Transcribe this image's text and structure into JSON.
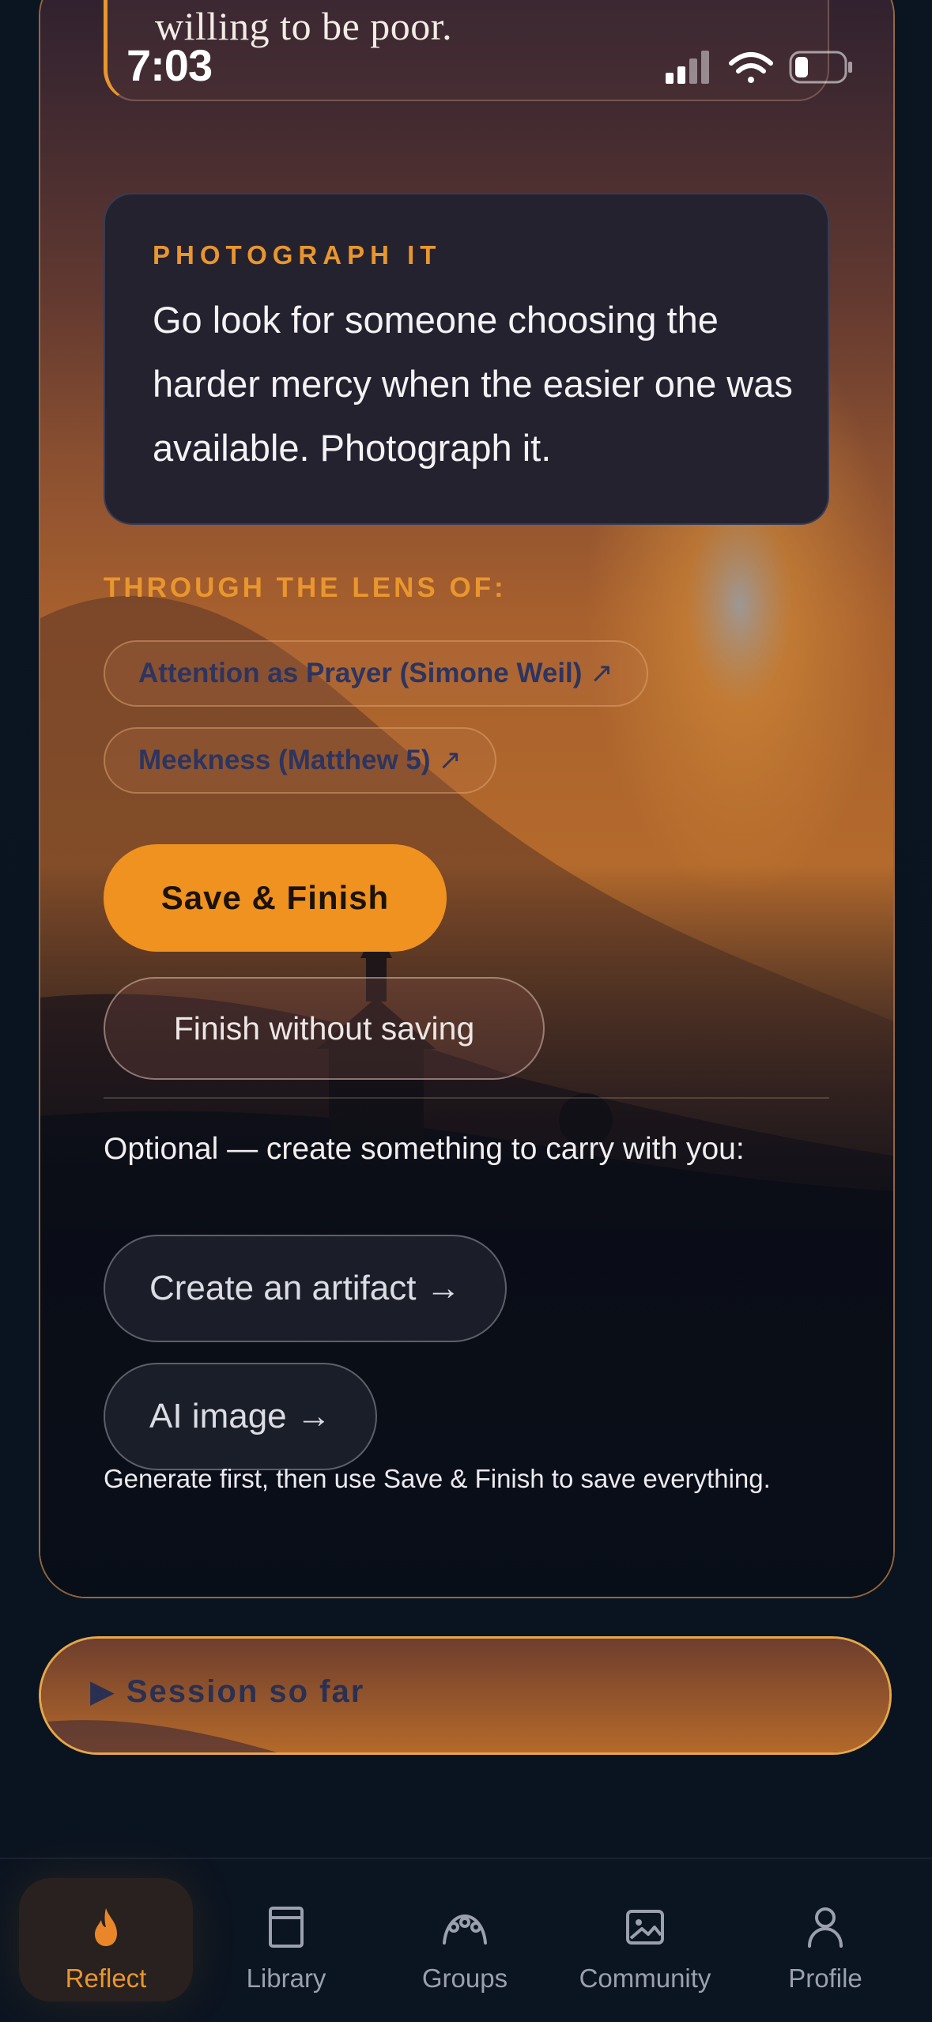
{
  "status_bar": {
    "time": "7:03"
  },
  "reflection": {
    "quote_tail": "willing to be poor.",
    "photograph": {
      "label": "PHOTOGRAPH IT",
      "prompt": "Go look for someone choosing the harder mercy when the easier one was available. Photograph it."
    },
    "lens": {
      "label": "THROUGH THE LENS OF:",
      "chips": [
        {
          "label": "Attention as Prayer (Simone Weil)",
          "arrow": "↗"
        },
        {
          "label": "Meekness (Matthew 5)",
          "arrow": "↗"
        }
      ]
    },
    "actions": {
      "save_label": "Save & Finish",
      "finish_label": "Finish without saving"
    },
    "optional": {
      "intro": "Optional — create something to carry with you:",
      "artifact_label": "Create an artifact →",
      "ai_image_label": "AI image →",
      "helper": "Generate first, then use Save & Finish to save everything."
    }
  },
  "session": {
    "label": "▶ Session so far"
  },
  "nav": {
    "items": [
      {
        "label": "Reflect",
        "icon": "flame-icon",
        "active": true
      },
      {
        "label": "Library",
        "icon": "book-icon"
      },
      {
        "label": "Groups",
        "icon": "groups-icon"
      },
      {
        "label": "Community",
        "icon": "image-icon"
      },
      {
        "label": "Profile",
        "icon": "person-icon"
      }
    ]
  },
  "colors": {
    "accent": "#f0921f",
    "background": "#0a1420",
    "card": "#24222f"
  }
}
